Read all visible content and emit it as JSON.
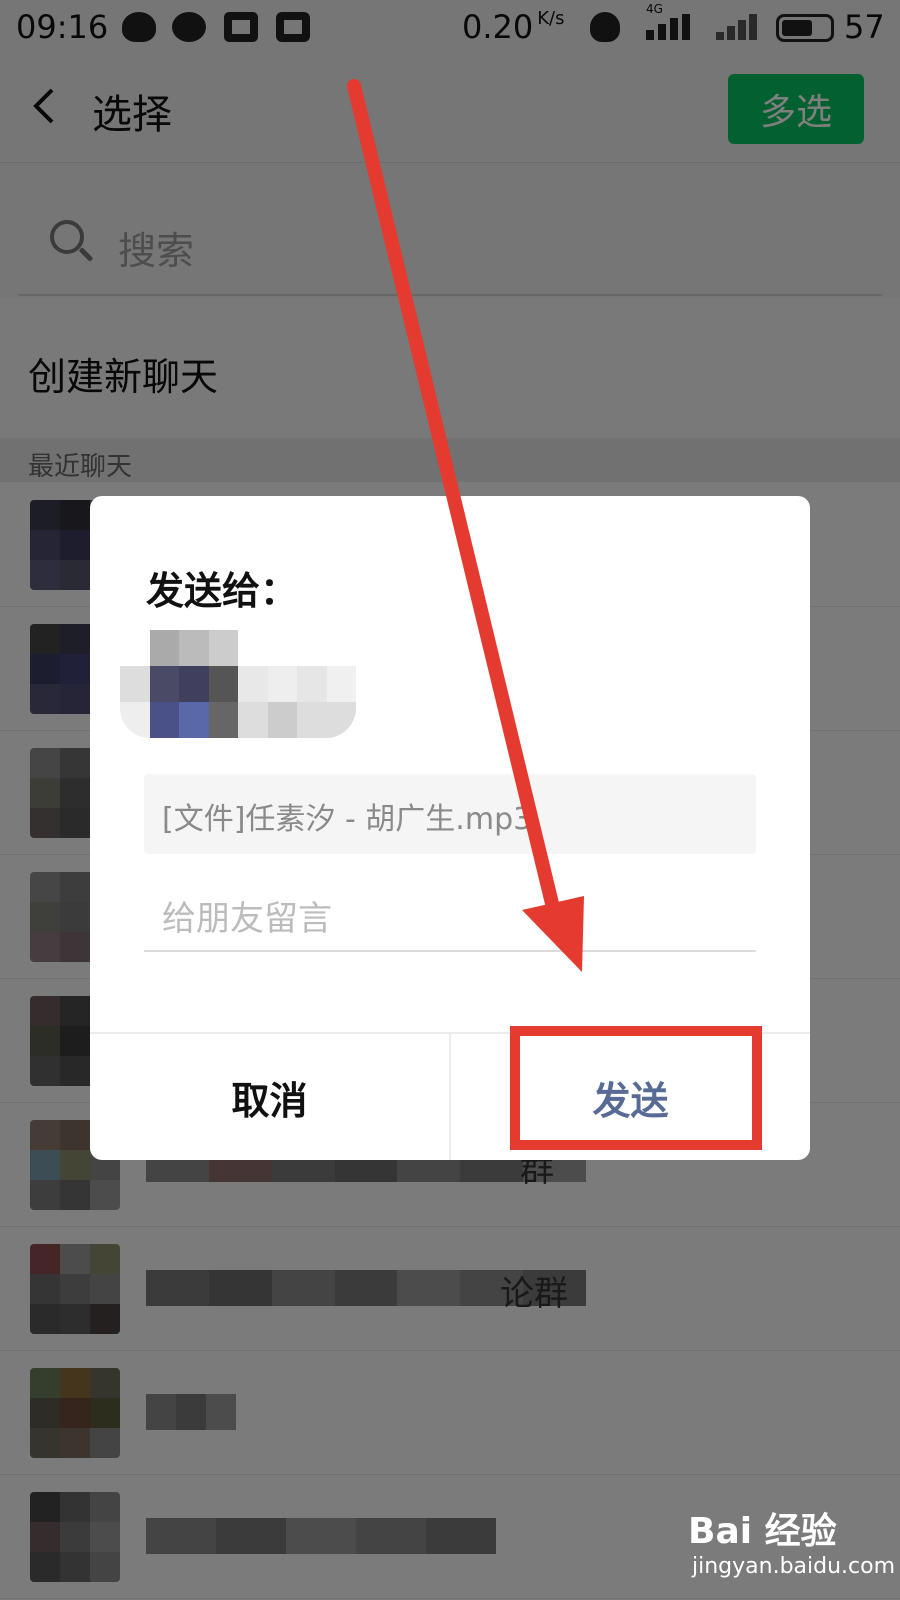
{
  "status_bar": {
    "time": "09:16",
    "net_speed": "0.20",
    "net_unit": "K/s",
    "network_type": "4G",
    "battery": "57"
  },
  "header": {
    "title": "选择",
    "multi_select_label": "多选"
  },
  "search": {
    "placeholder": "搜索"
  },
  "new_chat": {
    "label": "创建新聊天"
  },
  "recent_section": {
    "label": "最近聊天"
  },
  "contacts_partial": {
    "label_1": "群",
    "label_2": "论群"
  },
  "dialog": {
    "title": "发送给：",
    "file_label": "[文件]任素汐 - 胡广生.mp3",
    "message_placeholder": "给朋友留言",
    "cancel_label": "取消",
    "send_label": "发送"
  },
  "watermark": {
    "brand": "Bai 经验",
    "url": "jingyan.baidu.com"
  },
  "colors": {
    "accent_green": "#07c160",
    "send_blue": "#576b95",
    "highlight_red": "#e53a2f"
  },
  "icons": [
    "back-arrow-icon",
    "search-icon",
    "qq-icon",
    "wechat-icon",
    "sim-card-icon",
    "pocket-icon",
    "bell-icon",
    "signal-icon",
    "battery-icon"
  ]
}
